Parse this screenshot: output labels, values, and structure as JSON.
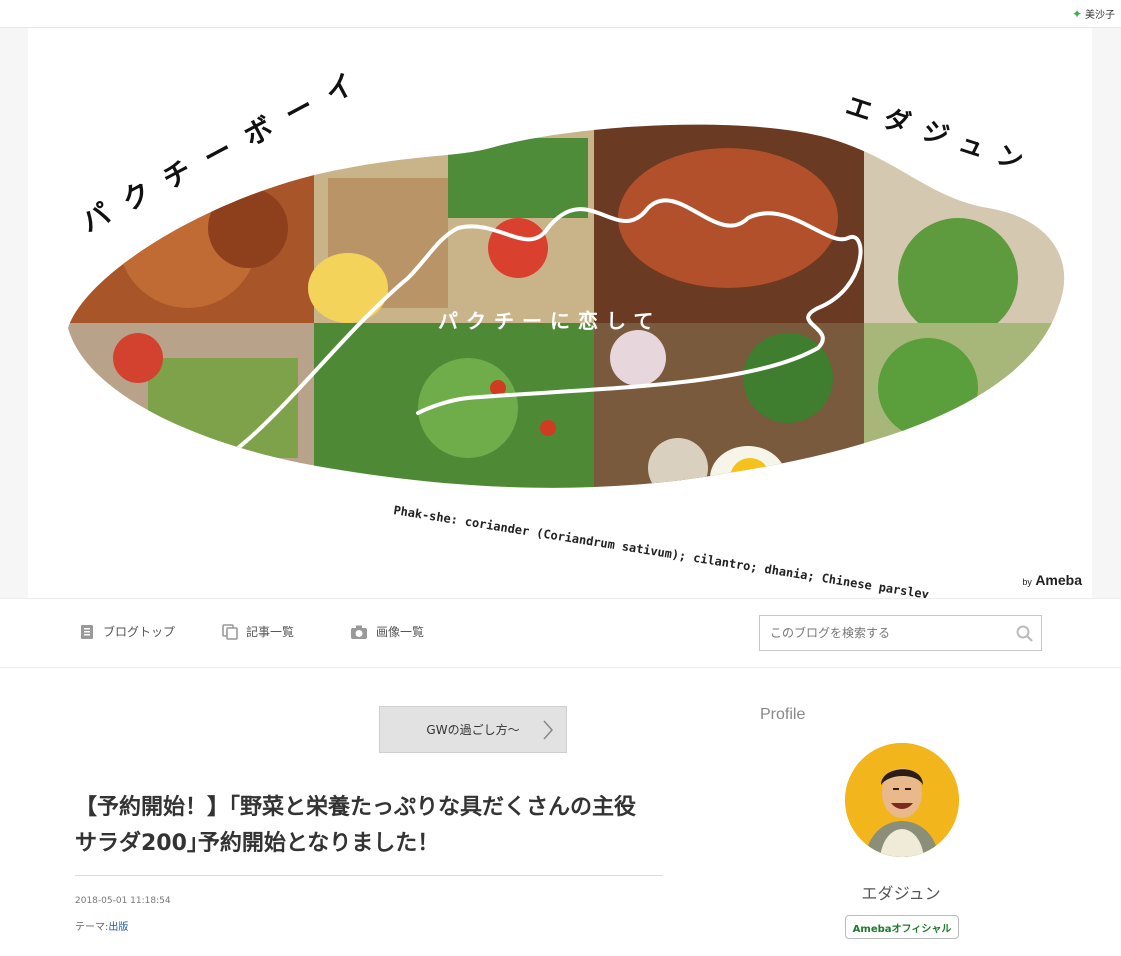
{
  "topbar": {
    "user_name": "美沙子"
  },
  "header": {
    "title_left": "パクチーボーイ",
    "title_right": "エダジュン",
    "tagline": "パクチーに恋して",
    "caption": "Phak-she: coriander (Coriandrum sativum); cilantro; dhania; Chinese parsley",
    "by_label": "by",
    "brand": "Ameba"
  },
  "nav": {
    "blog_top": "ブログトップ",
    "articles": "記事一覧",
    "images": "画像一覧",
    "search_placeholder": "このブログを検索する"
  },
  "main": {
    "prev_button": "GWの過ごし方～",
    "title_line1": "【予約開始！】｢野菜と栄養たっぷりな具だくさんの主役",
    "title_line2": "サラダ200｣予約開始となりました！",
    "date": "2018-05-01 11:18:54",
    "theme_label": "テーマ:",
    "theme_value": "出版"
  },
  "sidebar": {
    "heading": "Profile",
    "name": "エダジュン",
    "badge": "Amebaオフィシャル"
  },
  "colors": {
    "accent_green": "#3cb043",
    "link_blue": "#1a5aa8",
    "badge_green": "#1d7a2a",
    "avatar_bg": "#f3b51c"
  }
}
